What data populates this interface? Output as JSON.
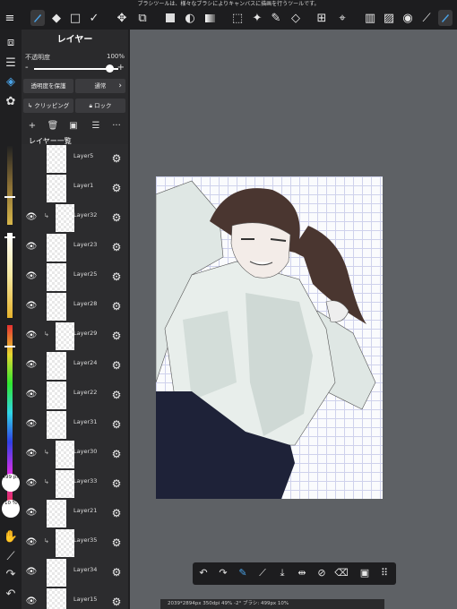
{
  "tip": "ブラシツールは、様々なブラシによりキャンバスに描画を行うツールです。",
  "toolbar": {
    "icons": [
      "menu-icon",
      "brush-icon",
      "eraser-icon",
      "select-rect-icon",
      "smudge-icon",
      "move-icon",
      "transform-icon",
      "fill-color-swatch-icon",
      "bucket-icon",
      "gradient-icon",
      "marquee-icon",
      "magic-wand-icon",
      "select-pen-icon",
      "select-eraser-icon",
      "layers-panel-icon",
      "snap-icon",
      "rotate-icon",
      "ruler-icon",
      "pen-accent-icon"
    ]
  },
  "panel": {
    "title": "レイヤー",
    "opacity_label": "不透明度",
    "opacity_value": "100%",
    "opacity": 1.0,
    "protect_alpha": "透明度を保護",
    "blend_mode": "通常",
    "clipping": "クリッピング",
    "lock": "ロック",
    "list_title": "レイヤー一覧"
  },
  "layers": [
    {
      "name": "Layer5",
      "visible": false,
      "clipped": false
    },
    {
      "name": "Layer1",
      "visible": false,
      "clipped": false
    },
    {
      "name": "Layer32",
      "visible": true,
      "clipped": true
    },
    {
      "name": "Layer23",
      "visible": true,
      "clipped": false
    },
    {
      "name": "Layer25",
      "visible": true,
      "clipped": false
    },
    {
      "name": "Layer28",
      "visible": true,
      "clipped": false
    },
    {
      "name": "Layer29",
      "visible": true,
      "clipped": true
    },
    {
      "name": "Layer24",
      "visible": true,
      "clipped": false
    },
    {
      "name": "Layer22",
      "visible": true,
      "clipped": false
    },
    {
      "name": "Layer31",
      "visible": true,
      "clipped": false
    },
    {
      "name": "Layer30",
      "visible": true,
      "clipped": true
    },
    {
      "name": "Layer33",
      "visible": true,
      "clipped": true
    },
    {
      "name": "Layer21",
      "visible": true,
      "clipped": false
    },
    {
      "name": "Layer35",
      "visible": true,
      "clipped": true
    },
    {
      "name": "Layer34",
      "visible": true,
      "clipped": false
    },
    {
      "name": "Layer15",
      "visible": true,
      "clipped": false
    }
  ],
  "brush": {
    "size": "499 px",
    "opacity": "10 %"
  },
  "status": "2039*2894px 350dpi 49% -2° ブラシ: 499px 10%",
  "colors": {
    "accent": "#4aa3e8",
    "panel": "#2a2a2c",
    "bar": "#1d1d1f",
    "skirt": "#1e2238",
    "hair": "#4a3630"
  }
}
